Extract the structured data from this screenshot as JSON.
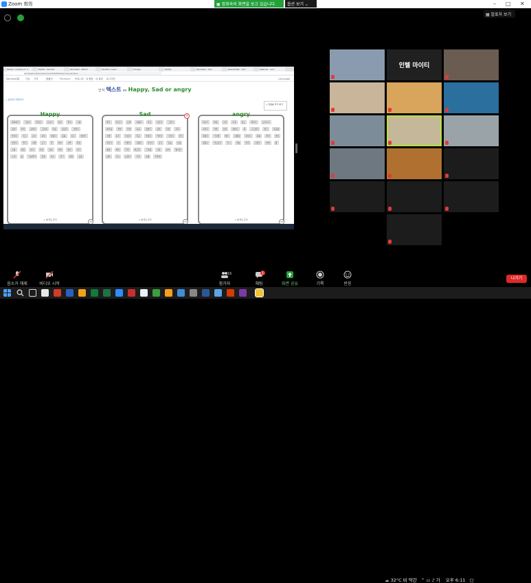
{
  "titlebar": {
    "title": "Zoom 회의",
    "min": "–",
    "max": "□",
    "close": "✕"
  },
  "share_banner": {
    "text": "▣ 정희숙의 화면을 보고 있습니다.",
    "view_options": "옵션 보기 ⌄"
  },
  "speaker_view": "▦ 발표자 보기",
  "shared_screen": {
    "tabs": [
      "Padlet / mystery in 2",
      "Padlet · teacher",
      "Wordwall · Match",
      "Quizlet | Learn",
      "Google",
      "Padlet",
      "Wordwall · Sort",
      "Real Padlet · Sort",
      "MadLibs · sort"
    ],
    "url": "wordwall.net/ko/resource/21093543/sort-by-emotion",
    "menubar": [
      "Wordwall",
      "홈",
      "기능",
      "가격",
      "템플릿",
      "Premium",
      "커뮤니티",
      "내 활동",
      "내 결과",
      "로그아웃",
      "Language"
    ],
    "title": {
      "pre": "인식",
      "main": "텍스트",
      "as": "as",
      "cats": "Happy, Sad or angry"
    },
    "share_link": "< 공유하기 클릭하기",
    "add_button": "+ 자료를 추가 하기",
    "buckets": [
      {
        "name": "Happy",
        "count": "72",
        "add_label": "+ 새 카드 추가",
        "cards": [
          "행복하다",
          "기쁘다",
          "즐겁다",
          "신난다",
          "웃다",
          "좋아",
          "사랑",
          "설레",
          "우와",
          "설레다",
          "고마워",
          "따뜻",
          "반갑다",
          "귀엽다",
          "멋지다",
          "최고",
          "감사",
          "축하",
          "재밌다",
          "웃음",
          "친구",
          "예쁘다",
          "맛있다",
          "좋다",
          "여행",
          "신기",
          "꽃",
          "하하",
          "선물",
          "칭찬",
          "소풍",
          "생일",
          "놀이",
          "자랑",
          "성공",
          "희망",
          "편안",
          "쉬다",
          "노래",
          "춤",
          "기분좋다",
          "햇살",
          "박수",
          "휴가",
          "평화",
          "감동"
        ]
      },
      {
        "name": "Sad",
        "count": "72",
        "add_label": "+ 새 카드 추가",
        "cards": [
          "울다",
          "슬프다",
          "눈물",
          "외롭다",
          "미안",
          "아프다",
          "그립다",
          "헤어짐",
          "쓸쓸",
          "우울",
          "속상",
          "힘들다",
          "실망",
          "걱정",
          "후회",
          "이별",
          "혼자",
          "아쉽다",
          "피곤",
          "무섭다",
          "약하다",
          "다쳤다",
          "잃다",
          "떠나다",
          "비",
          "어둡다",
          "괴롭다",
          "지치다",
          "포기",
          "한숨",
          "흐림",
          "병원",
          "불쌍",
          "추워",
          "배고파",
          "그리움",
          "서운",
          "상처",
          "떨어짐",
          "실패",
          "가난",
          "눈물나",
          "지루",
          "슬픔",
          "우울해"
        ]
      },
      {
        "name": "angry",
        "count": "72",
        "add_label": "+ 새 카드 추가",
        "cards": [
          "화나다",
          "짜증",
          "싫다",
          "미워",
          "분노",
          "때리다",
          "소리치다",
          "싸우다",
          "억울",
          "답답",
          "열받다",
          "욕",
          "시끄럽다",
          "밉다",
          "불공평",
          "못됐다",
          "거짓말",
          "뺏다",
          "괴롭힘",
          "화내다",
          "싸움",
          "폭력",
          "불만",
          "짜증나",
          "약오르다",
          "무시",
          "괘씸",
          "버럭",
          "귀찮다",
          "방해",
          "쾅"
        ]
      }
    ]
  },
  "gallery": [
    {
      "name": "",
      "muted": true
    },
    {
      "name": "인텔 마이티",
      "muted": false
    },
    {
      "name": "",
      "muted": true
    },
    {
      "name": "",
      "muted": true
    },
    {
      "name": "",
      "muted": true
    },
    {
      "name": "",
      "muted": true
    },
    {
      "name": "",
      "muted": true
    },
    {
      "name": "",
      "muted": true
    },
    {
      "name": "",
      "muted": true
    },
    {
      "name": "",
      "muted": true
    },
    {
      "name": "",
      "muted": true
    },
    {
      "name": "",
      "muted": true
    },
    {
      "name": "",
      "muted": true
    },
    {
      "name": "",
      "muted": true
    },
    {
      "name": "",
      "muted": true
    },
    {
      "name": "",
      "muted": true
    }
  ],
  "toolbar": {
    "mute": "음소거 해제",
    "video": "비디오 시작",
    "participants": "참가자",
    "participants_count": "16",
    "chat": "채팅",
    "chat_badge": "1",
    "share": "화면 공유",
    "record": "기록",
    "reactions": "반응",
    "end": "나가기"
  },
  "tray": {
    "temp": "32°C 비 약간",
    "time": "오후 6:11",
    "ime": "가"
  },
  "colors": {
    "banner": "#23a13b",
    "end": "#e02828",
    "selected": "#b6e03a",
    "muted": "#e53935"
  }
}
